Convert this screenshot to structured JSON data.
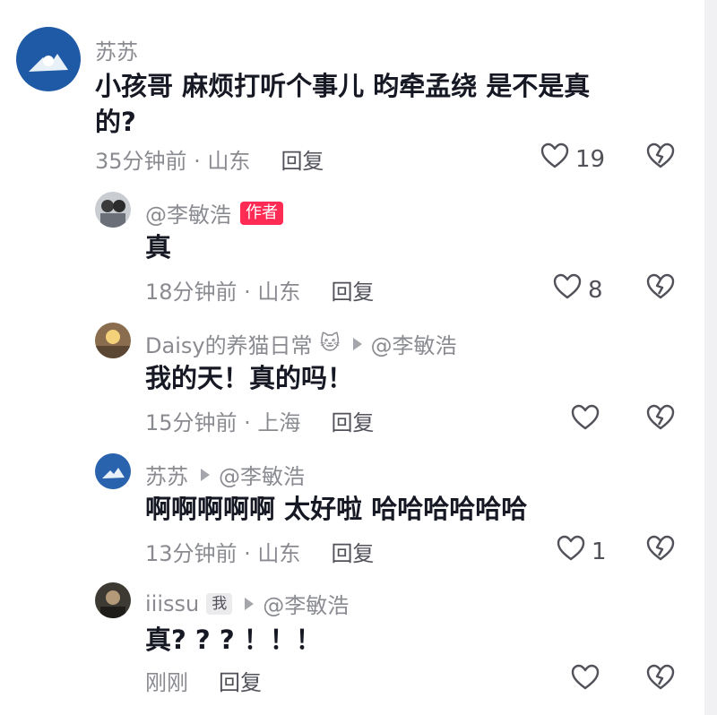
{
  "comments": [
    {
      "username": "苏苏",
      "content_line1": "小孩哥  麻烦打听个事儿    昀牵孟绕  是不是真",
      "content_line2": "的?",
      "time": "35分钟前 · 山东",
      "reply_label": "回复",
      "likes": "19"
    },
    {
      "username": "@李敏浩",
      "badge": "作者",
      "content": "真",
      "time": "18分钟前 · 山东",
      "reply_label": "回复",
      "likes": "8"
    },
    {
      "username": "Daisy的养猫日常",
      "emoji": "🐱",
      "reply_to": "@李敏浩",
      "content": "我的天！真的吗！",
      "time": "15分钟前 · 上海",
      "reply_label": "回复"
    },
    {
      "username": "苏苏",
      "reply_to": "@李敏浩",
      "content": "啊啊啊啊啊   太好啦   哈哈哈哈哈哈",
      "time": "13分钟前 · 山东",
      "reply_label": "回复",
      "likes": "1"
    },
    {
      "username": "iiissu",
      "badge": "我",
      "reply_to": "@李敏浩",
      "content": "真? ? ? ！！！",
      "time": "刚刚",
      "reply_label": "回复"
    }
  ],
  "colors": {
    "author_badge": "#fe2c55",
    "text": "#161823",
    "meta": "#8a8b91"
  },
  "icons": {
    "like": "heart-outline-icon",
    "dislike": "broken-heart-icon",
    "reply_arrow": "triangle-right-icon"
  }
}
